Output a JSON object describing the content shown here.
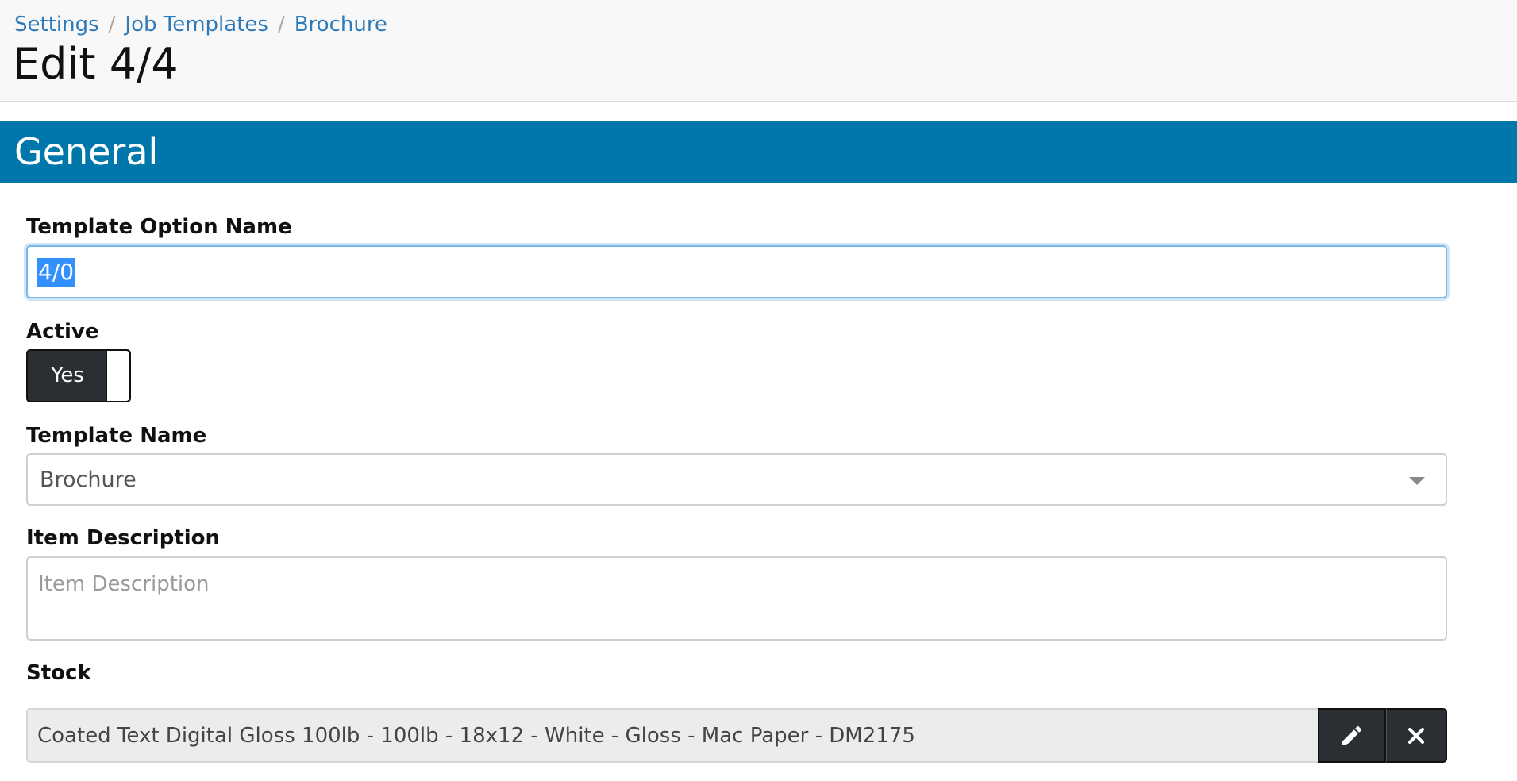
{
  "breadcrumb": {
    "items": [
      "Settings",
      "Job Templates",
      "Brochure"
    ],
    "separator": "/"
  },
  "page_title": "Edit 4/4",
  "section": {
    "title": "General"
  },
  "fields": {
    "template_option_name": {
      "label": "Template Option Name",
      "value": "4/0"
    },
    "active": {
      "label": "Active",
      "toggle_label": "Yes",
      "state": "on"
    },
    "template_name": {
      "label": "Template Name",
      "selected": "Brochure"
    },
    "item_description": {
      "label": "Item Description",
      "placeholder": "Item Description"
    },
    "stock": {
      "label": "Stock",
      "value": "Coated Text Digital Gloss 100lb - 100lb - 18x12 - White - Gloss - Mac Paper - DM2175"
    }
  },
  "icons": {
    "edit": "pencil-icon",
    "remove": "close-icon",
    "dropdown": "caret-down-icon"
  },
  "colors": {
    "section_bar": "#0077aa",
    "link": "#2f7ab8",
    "button_dark": "#2b2f33",
    "focus_border": "#7ab8ec"
  }
}
